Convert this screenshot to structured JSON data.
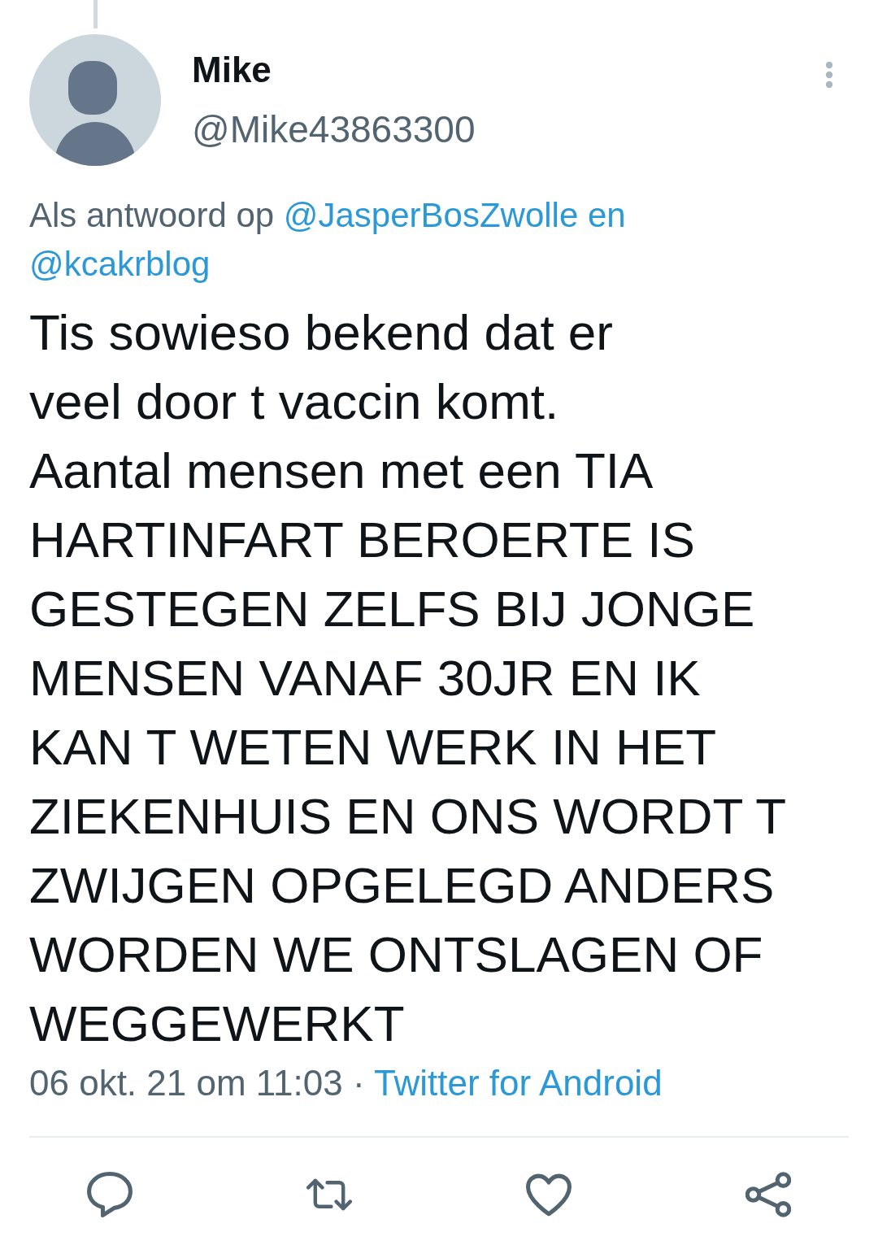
{
  "author": {
    "name": "Mike",
    "handle": "@Mike43863300"
  },
  "reply_context": {
    "label": "Als antwoord op",
    "mentions": [
      "@JasperBosZwolle",
      "@kcakrblog"
    ],
    "joiner": "en"
  },
  "text": "Tis sowieso bekend dat er\nveel door t vaccin komt.\nAantal mensen met een TIA HARTINFART BEROERTE IS GESTEGEN ZELFS BIJ JONGE MENSEN VANAF 30JR EN IK KAN T WETEN WERK IN HET ZIEKENHUIS EN ONS WORDT T ZWIJGEN OPGELEGD ANDERS WORDEN WE ONTSLAGEN OF WEGGEWERKT",
  "meta": {
    "timestamp": "06 okt. 21 om 11:03",
    "separator": "·",
    "source": "Twitter for Android"
  },
  "actions": [
    {
      "kind": "reply"
    },
    {
      "kind": "retweet"
    },
    {
      "kind": "like"
    },
    {
      "kind": "share"
    }
  ]
}
